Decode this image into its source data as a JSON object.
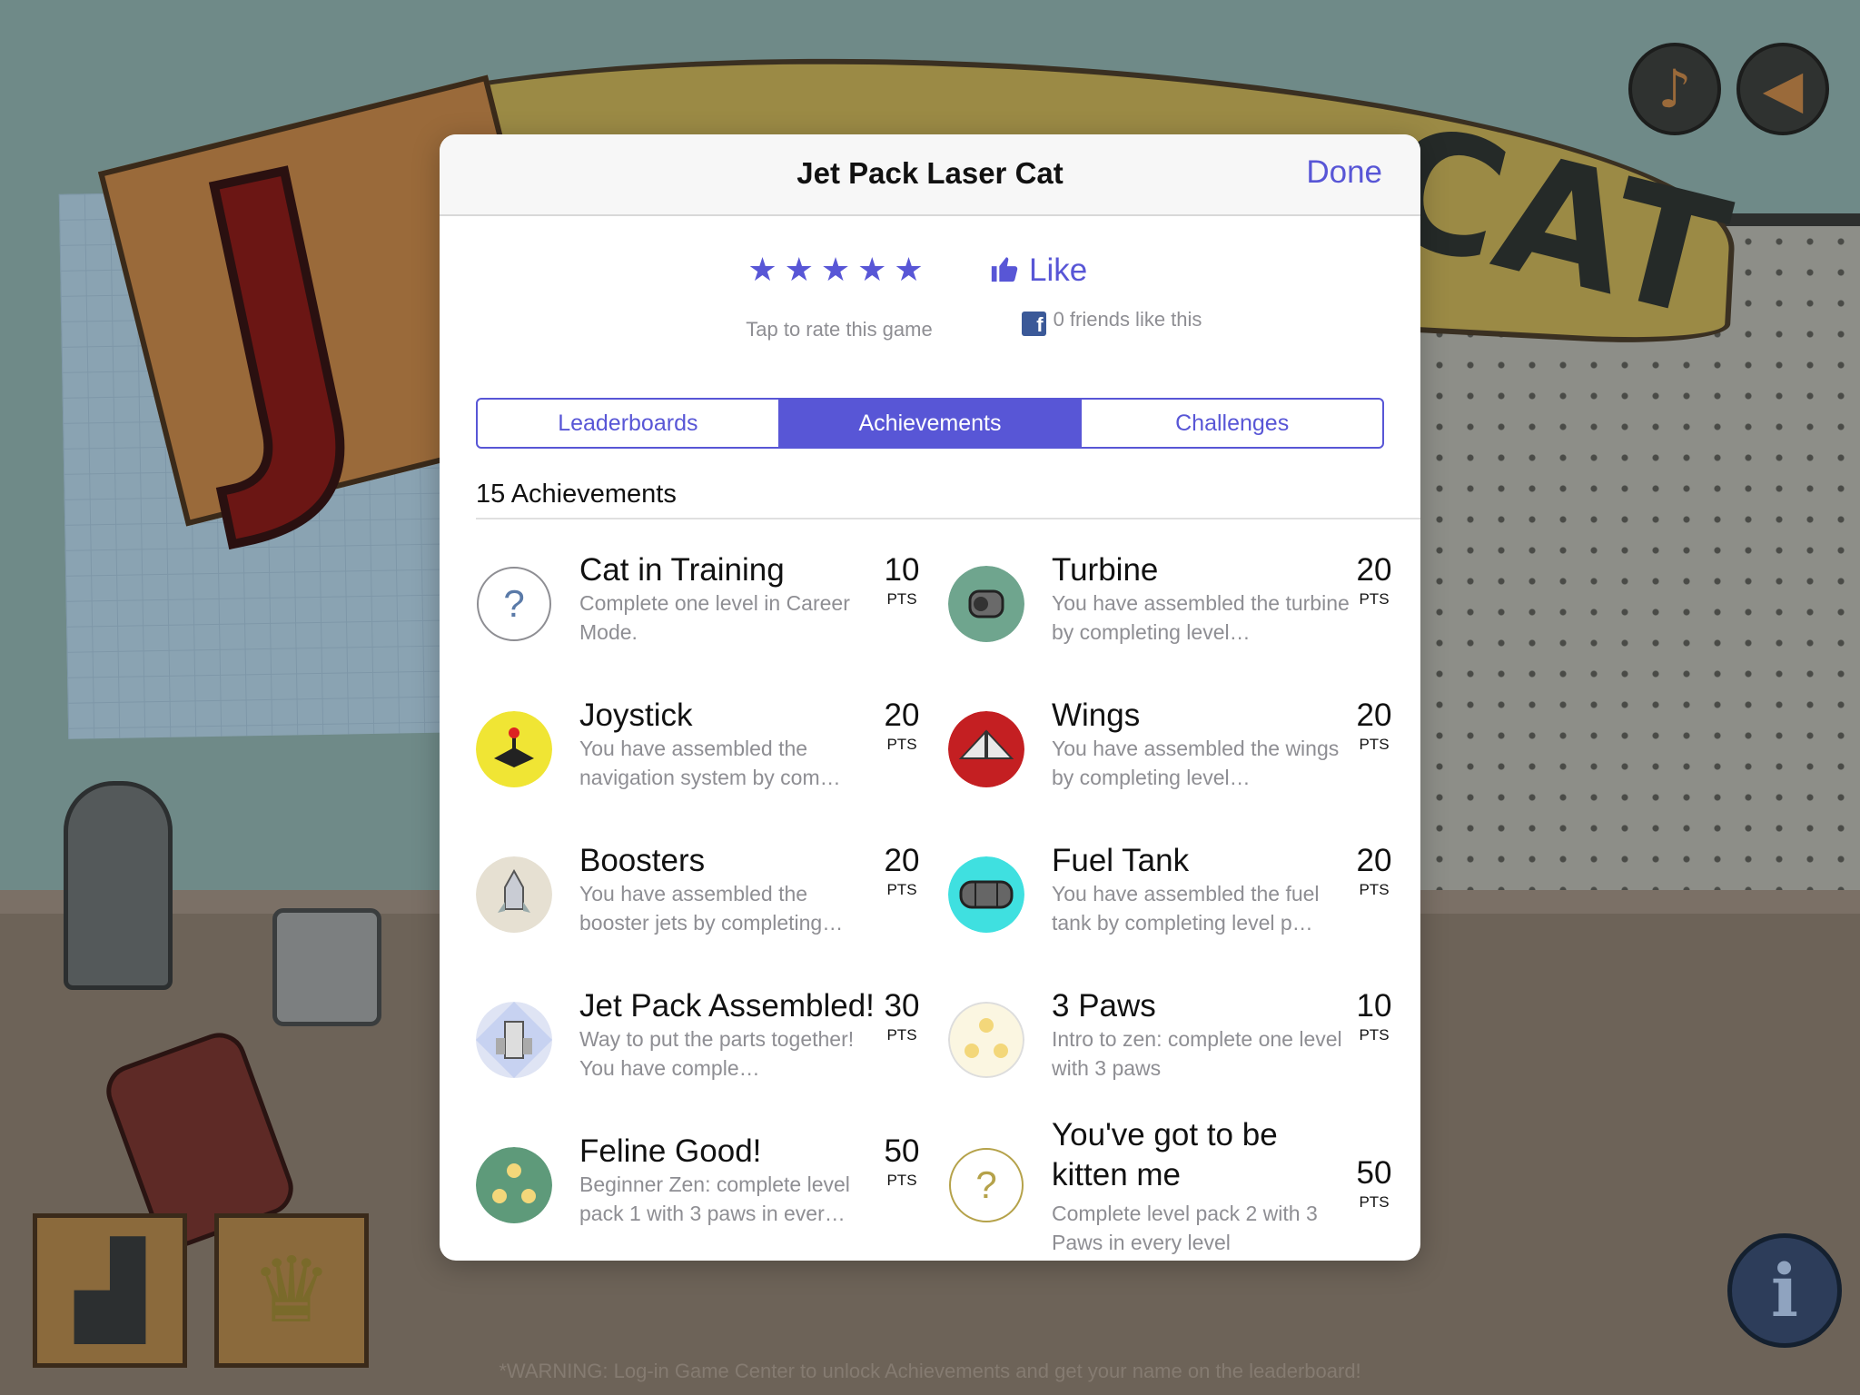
{
  "sheet": {
    "title": "Jet Pack Laser Cat",
    "done_label": "Done",
    "stars": "★★★★★",
    "rate_label": "Tap to rate this game",
    "like_label": "Like",
    "friends_label": "0 friends like this",
    "tabs": [
      {
        "label": "Leaderboards"
      },
      {
        "label": "Achievements"
      },
      {
        "label": "Challenges"
      }
    ],
    "active_tab": "Achievements",
    "achievements_count": "15 Achievements",
    "pts_label": "PTS",
    "achievements": [
      {
        "name": "Cat in Training",
        "description": "Complete one level in Career Mode.",
        "points": "10",
        "icon": "question-icon"
      },
      {
        "name": "Turbine",
        "description": "You have assembled the turbine by completing level…",
        "points": "20",
        "icon": "turbine-icon"
      },
      {
        "name": "Joystick",
        "description": "You have assembled the navigation system by com…",
        "points": "20",
        "icon": "joystick-icon"
      },
      {
        "name": "Wings",
        "description": "You have assembled the wings by completing level…",
        "points": "20",
        "icon": "wings-icon"
      },
      {
        "name": "Boosters",
        "description": "You have assembled the booster jets by completing…",
        "points": "20",
        "icon": "booster-icon"
      },
      {
        "name": "Fuel Tank",
        "description": "You have assembled the fuel tank by completing level p…",
        "points": "20",
        "icon": "fuel-tank-icon"
      },
      {
        "name": "Jet Pack Assembled!",
        "description": "Way to put the parts together! You have comple…",
        "points": "30",
        "icon": "jet-pack-icon"
      },
      {
        "name": "3 Paws",
        "description": "Intro to zen: complete one level with 3 paws",
        "points": "10",
        "icon": "paws-icon"
      },
      {
        "name": "Feline Good!",
        "description": "Beginner Zen: complete level pack 1 with 3 paws in ever…",
        "points": "50",
        "icon": "paws-green-icon"
      },
      {
        "name": "You've got to be kitten me",
        "description": "Complete level pack 2 with 3 Paws in every level",
        "points": "50",
        "icon": "question-gold-icon"
      }
    ]
  },
  "background": {
    "warning": "*WARNING: Log-in Game Center to unlock Achievements and get your name on the leaderboard!"
  },
  "colors": {
    "accent": "#5856d6"
  }
}
